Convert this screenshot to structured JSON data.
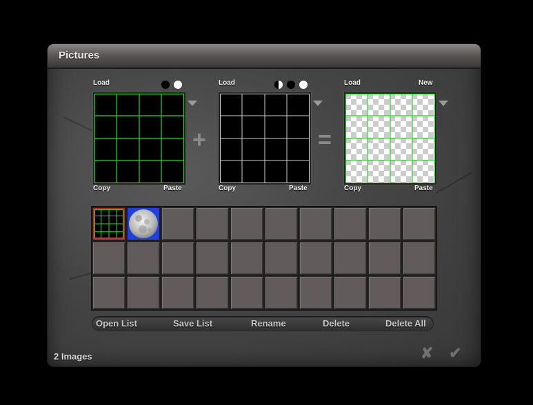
{
  "window": {
    "title": "Pictures"
  },
  "panels": [
    {
      "id": "source1",
      "top_left": "Load",
      "top_right": "",
      "bottom_left": "Copy",
      "bottom_right": "Paste",
      "dots": [
        "black-dot-icon",
        "white-dot-icon"
      ]
    },
    {
      "id": "source2",
      "top_left": "Load",
      "top_right": "",
      "bottom_left": "Copy",
      "bottom_right": "Paste",
      "dots": [
        "half-dot-icon",
        "black-dot-icon",
        "white-dot-icon"
      ]
    },
    {
      "id": "result",
      "top_left": "Load",
      "top_right": "New",
      "bottom_left": "Copy",
      "bottom_right": "Paste",
      "dots": []
    }
  ],
  "operators": {
    "plus": "+",
    "equals": "="
  },
  "image_list": {
    "columns": 10,
    "rows": 3,
    "filled": [
      {
        "icon": "green-grid-thumbnail",
        "selected": true
      },
      {
        "icon": "moon-thumbnail",
        "selected": false
      }
    ]
  },
  "toolbar": {
    "open_list": "Open List",
    "save_list": "Save List",
    "rename": "Rename",
    "delete": "Delete",
    "delete_all": "Delete All"
  },
  "status": {
    "count": "2 Images"
  },
  "actions": {
    "cancel_icon": "x-icon",
    "ok_icon": "check-icon"
  },
  "colors": {
    "grid_green": "#22dd22",
    "selected_border": "#d02020",
    "cell": "#625b5b",
    "moon_bg": "#1f3fe0"
  }
}
